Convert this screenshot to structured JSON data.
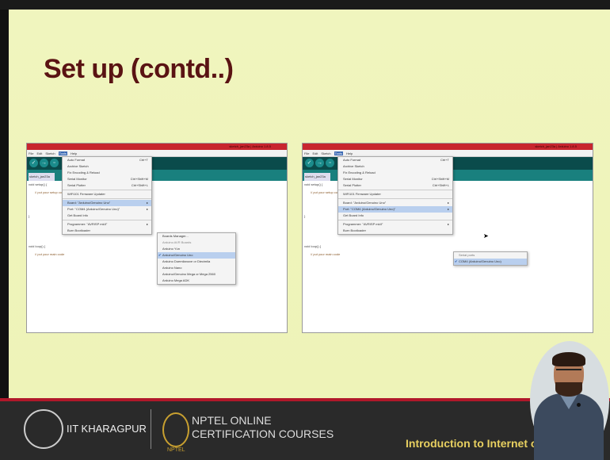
{
  "slide": {
    "title": "Set up (contd..)"
  },
  "left_screenshot": {
    "window_title": "sketch_jan23a | Arduino 1.8.5",
    "menubar": [
      "File",
      "Edit",
      "Sketch",
      "Tools",
      "Help"
    ],
    "active_menu": "Tools",
    "tab_label": "sketch_jan23a",
    "code_lines": [
      "void setup() {",
      "// put your setup code",
      "}",
      "void loop() {",
      "// put your main code"
    ],
    "tools_menu": [
      {
        "label": "Auto Format",
        "shortcut": "Ctrl+T"
      },
      {
        "label": "Archive Sketch",
        "shortcut": ""
      },
      {
        "label": "Fix Encoding & Reload",
        "shortcut": ""
      },
      {
        "label": "Serial Monitor",
        "shortcut": "Ctrl+Shift+M"
      },
      {
        "label": "Serial Plotter",
        "shortcut": "Ctrl+Shift+L"
      },
      {
        "label": "WiFi101 Firmware Updater",
        "shortcut": ""
      },
      {
        "label": "Board: \"Arduino/Genuino Uno\"",
        "shortcut": ""
      },
      {
        "label": "Port: \"COM4 (Arduino/Genuino Uno)\"",
        "shortcut": ""
      },
      {
        "label": "Get Board Info",
        "shortcut": ""
      },
      {
        "label": "Programmer: \"AVRISP mkII\"",
        "shortcut": ""
      },
      {
        "label": "Burn Bootloader",
        "shortcut": ""
      }
    ],
    "board_submenu": [
      "Boards Manager...",
      "Arduino AVR Boards",
      "Arduino Yún",
      "Arduino/Genuino Uno",
      "Arduino Duemilanove or Diecimila",
      "Arduino Nano",
      "Arduino/Genuino Mega or Mega 2560",
      "Arduino Mega ADK"
    ],
    "board_selected": "Arduino/Genuino Uno"
  },
  "right_screenshot": {
    "window_title": "sketch_jan23a | Arduino 1.8.5",
    "menubar": [
      "File",
      "Edit",
      "Sketch",
      "Tools",
      "Help"
    ],
    "active_menu": "Tools",
    "tab_label": "sketch_jan23a",
    "code_lines": [
      "void setup() {",
      "// put your setup code",
      "}",
      "void loop() {",
      "// put your main code"
    ],
    "tools_menu": [
      {
        "label": "Auto Format",
        "shortcut": "Ctrl+T"
      },
      {
        "label": "Archive Sketch",
        "shortcut": ""
      },
      {
        "label": "Fix Encoding & Reload",
        "shortcut": ""
      },
      {
        "label": "Serial Monitor",
        "shortcut": "Ctrl+Shift+M"
      },
      {
        "label": "Serial Plotter",
        "shortcut": "Ctrl+Shift+L"
      },
      {
        "label": "WiFi101 Firmware Updater",
        "shortcut": ""
      },
      {
        "label": "Board: \"Arduino/Genuino Uno\"",
        "shortcut": ""
      },
      {
        "label": "Port: \"COM4 (Arduino/Genuino Uno)\"",
        "shortcut": ""
      },
      {
        "label": "Get Board Info",
        "shortcut": ""
      },
      {
        "label": "Programmer: \"AVRISP mkII\"",
        "shortcut": ""
      },
      {
        "label": "Burn Bootloader",
        "shortcut": ""
      }
    ],
    "port_submenu": [
      "Serial ports",
      "COM4 (Arduino/Genuino Uno)"
    ],
    "port_selected": "COM4 (Arduino/Genuino Uno)"
  },
  "footer": {
    "org": "IIT KHARAGPUR",
    "course_line1": "NPTEL ONLINE",
    "course_line2": "CERTIFICATION COURSES",
    "nptel_small": "NPTEL",
    "lecture": "Introduction to Internet of Things"
  },
  "colors": {
    "slide_bg": "#eef3b8",
    "title": "#5a1313",
    "window_titlebar": "#c8252e",
    "arduino_toolbar": "#0a4b4b",
    "menu_highlight": "#b9cfee",
    "footer_accent": "#b0182a",
    "lecture_text": "#e8d060"
  }
}
